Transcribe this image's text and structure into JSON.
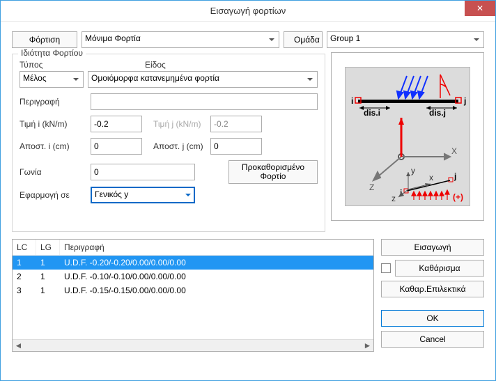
{
  "window": {
    "title": "Εισαγωγή φορτίων",
    "close": "✕"
  },
  "top": {
    "load_btn": "Φόρτιση",
    "loadtype_value": "Μόνιμα Φορτία",
    "group_label": "Ομάδα",
    "group_value": "Group 1"
  },
  "props": {
    "legend": "Ιδιότητα Φορτίου",
    "type_label": "Τύπος",
    "type_value": "Μέλος",
    "kind_label": "Είδος",
    "kind_value": "Ομοιόμορφα κατανεμημένα φορτία",
    "desc_label": "Περιγραφή",
    "desc_value": "",
    "val_i_label": "Τιμή i (kN/m)",
    "val_i_value": "-0.2",
    "val_j_label": "Τιμή j (kN/m)",
    "val_j_value": "-0.2",
    "dist_i_label": "Αποστ. i (cm)",
    "dist_i_value": "0",
    "dist_j_label": "Αποστ. j (cm)",
    "dist_j_value": "0",
    "angle_label": "Γωνία",
    "angle_value": "0",
    "apply_label": "Εφαρμογή σε",
    "apply_value": "Γενικός y",
    "preset_btn": "Προκαθορισμένο Φορτίο"
  },
  "preview": {
    "i": "i",
    "j": "j",
    "dis_i": "dis.i",
    "dis_j": "dis.j",
    "X": "X",
    "Y": "y",
    "Z": "Z",
    "x": "x",
    "z": "z",
    "plus": "(+)"
  },
  "table": {
    "headers": {
      "lc": "LC",
      "lg": "LG",
      "desc": "Περιγραφή"
    },
    "rows": [
      {
        "lc": "1",
        "lg": "1",
        "desc": "U.D.F. -0.20/-0.20/0.00/0.00/0.00",
        "selected": true
      },
      {
        "lc": "2",
        "lg": "1",
        "desc": "U.D.F. -0.10/-0.10/0.00/0.00/0.00",
        "selected": false
      },
      {
        "lc": "3",
        "lg": "1",
        "desc": "U.D.F. -0.15/-0.15/0.00/0.00/0.00",
        "selected": false
      }
    ]
  },
  "buttons": {
    "insert": "Εισαγωγή",
    "clear": "Καθάρισμα",
    "clear_sel": "Καθαρ.Επιλεκτικά",
    "ok": "OK",
    "cancel": "Cancel"
  }
}
